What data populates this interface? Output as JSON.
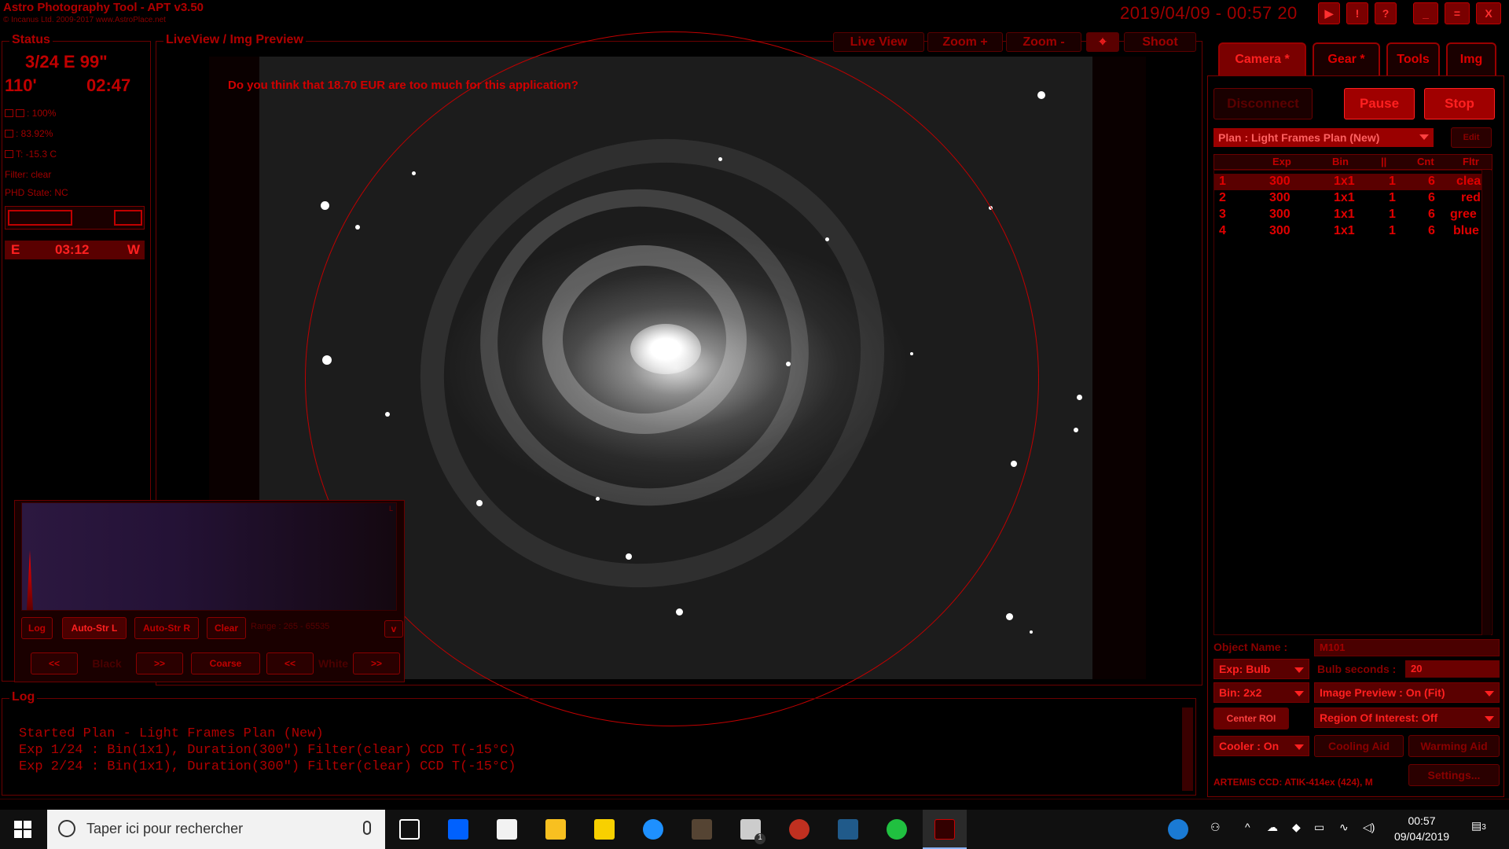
{
  "window": {
    "title": "Astro Photography Tool  -  APT v3.50",
    "copyright": "© Incanus Ltd. 2009-2017  www.AstroPlace.net",
    "clock": "2019/04/09 - 00:57 20",
    "btn_play": "▶",
    "btn_info": "!",
    "btn_help": "?",
    "btn_min": "_",
    "btn_max": "=",
    "btn_close": "X"
  },
  "status": {
    "title": "Status",
    "frames": "3/24 E  99\"",
    "angle": "110'",
    "time": "02:47",
    "battery": ": 100%",
    "humidity": ": 83.92%",
    "temp": "T:  -15.3 C",
    "filter": "Filter: clear",
    "phd": "PHD State: NC",
    "meridian_e": "E",
    "meridian_time": "03:12",
    "meridian_w": "W"
  },
  "preview": {
    "title": "LiveView / Img Preview",
    "btn_liveview": "Live View",
    "btn_zoom_in": "Zoom +",
    "btn_zoom_out": "Zoom -",
    "btn_target": "⌖",
    "btn_shoot": "Shoot",
    "nag": "Do you think that 18.70 EUR are too much for this application?"
  },
  "histogram": {
    "btn_log": "Log",
    "btn_auto_l": "Auto-Str L",
    "btn_auto_r": "Auto-Str R",
    "btn_clear": "Clear",
    "range": "Range : 265 - 65535",
    "btn_black_prev": "<<",
    "label_black": "Black",
    "btn_black_next": ">>",
    "btn_coarse": "Coarse",
    "btn_white_prev": "<<",
    "label_white": "White",
    "btn_white_next": ">>",
    "corner": "L",
    "expand": "v"
  },
  "tabs": [
    "Camera *",
    "Gear *",
    "Tools",
    "Img"
  ],
  "camera": {
    "btn_disconnect": "Disconnect",
    "btn_pause": "Pause",
    "btn_stop": "Stop",
    "plan": "Plan : Light Frames Plan (New)",
    "btn_edit": "Edit",
    "columns": [
      "Exp",
      "Bin",
      "||",
      "Cnt",
      "Fltr"
    ],
    "rows": [
      {
        "n": "1",
        "exp": "300",
        "bin": "1x1",
        "p": "1",
        "cnt": "6",
        "fltr": "clea"
      },
      {
        "n": "2",
        "exp": "300",
        "bin": "1x1",
        "p": "1",
        "cnt": "6",
        "fltr": "red"
      },
      {
        "n": "3",
        "exp": "300",
        "bin": "1x1",
        "p": "1",
        "cnt": "6",
        "fltr": "gree"
      },
      {
        "n": "4",
        "exp": "300",
        "bin": "1x1",
        "p": "1",
        "cnt": "6",
        "fltr": "blue"
      }
    ],
    "object_label": "Object Name :",
    "object_value": "M101",
    "exp_mode": "Exp: Bulb",
    "bulb_label": "Bulb seconds :",
    "bulb_value": "20",
    "bin": "Bin: 2x2",
    "image_preview": "Image Preview : On (Fit)",
    "btn_center_roi": "Center ROI",
    "roi": "Region Of Interest: Off",
    "cooler": "Cooler : On",
    "btn_cooling_aid": "Cooling Aid",
    "btn_warming_aid": "Warming Aid",
    "ccd_info": "ARTEMIS CCD: ATIK-414ex (424), M",
    "btn_settings": "Settings..."
  },
  "log": {
    "title": "Log",
    "lines": [
      "Started Plan - Light Frames Plan (New)",
      "Exp 1/24 : Bin(1x1), Duration(300\") Filter(clear) CCD T(-15°C)",
      "Exp 2/24 : Bin(1x1), Duration(300\") Filter(clear) CCD T(-15°C)"
    ]
  },
  "taskbar": {
    "search_placeholder": "Taper ici pour rechercher",
    "time": "00:57",
    "date": "09/04/2019",
    "notif_count": "3",
    "mail_badge": "1"
  }
}
